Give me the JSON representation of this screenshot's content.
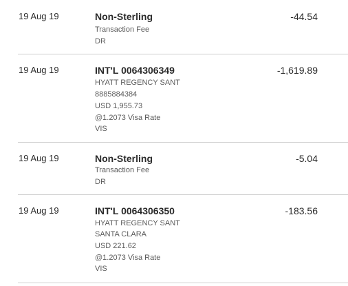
{
  "transactions": [
    {
      "date": "19 Aug 19",
      "title": "Non-Sterling",
      "amount": "-44.54",
      "details": [
        "Transaction Fee",
        "DR"
      ]
    },
    {
      "date": "19 Aug 19",
      "title": "INT'L 0064306349",
      "amount": "-1,619.89",
      "details": [
        "HYATT REGENCY SANT",
        "8885884384",
        "USD 1,955.73",
        "@1.2073 Visa Rate",
        "VIS"
      ]
    },
    {
      "date": "19 Aug 19",
      "title": "Non-Sterling",
      "amount": "-5.04",
      "details": [
        "Transaction Fee",
        "DR"
      ]
    },
    {
      "date": "19 Aug 19",
      "title": "INT'L 0064306350",
      "amount": "-183.56",
      "details": [
        "HYATT REGENCY SANT",
        "SANTA CLARA",
        "USD 221.62",
        "@1.2073 Visa Rate",
        "VIS"
      ]
    }
  ]
}
